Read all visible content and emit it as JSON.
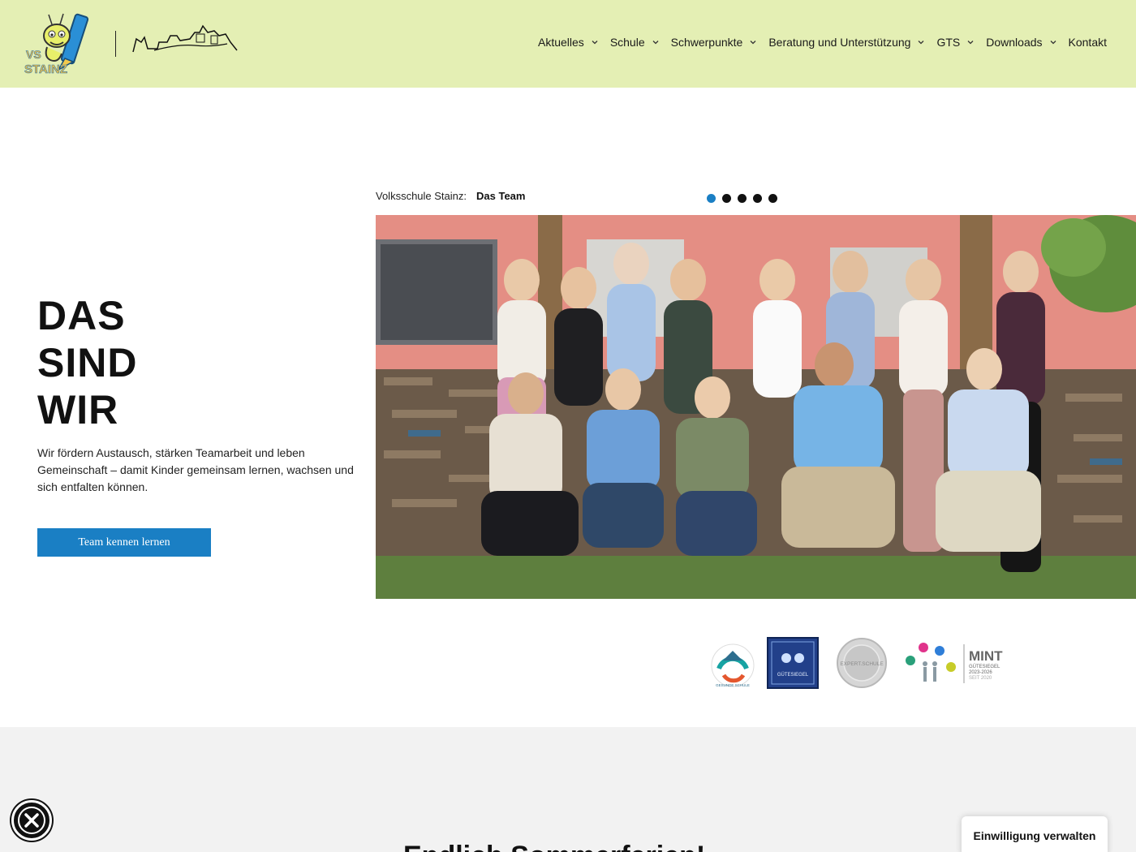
{
  "header": {
    "logo_text": "VS STAINZ",
    "nav": [
      {
        "label": "Aktuelles",
        "has_dropdown": true
      },
      {
        "label": "Schule",
        "has_dropdown": true
      },
      {
        "label": "Schwerpunkte",
        "has_dropdown": true
      },
      {
        "label": "Beratung und Unterstützung",
        "has_dropdown": true
      },
      {
        "label": "GTS",
        "has_dropdown": true
      },
      {
        "label": "Downloads",
        "has_dropdown": true
      },
      {
        "label": "Kontakt",
        "has_dropdown": false
      }
    ]
  },
  "hero": {
    "title_line1": "DAS",
    "title_line2": "SIND",
    "title_line3": "WIR",
    "text": "Wir fördern Austausch, stärken Teamarbeit und leben Gemeinschaft – damit Kinder gemeinsam lernen, wachsen und sich entfalten können.",
    "cta_label": "Team kennen lernen"
  },
  "slider": {
    "caption_prefix": "Volksschule Stainz:",
    "caption_title": "Das Team",
    "dot_count": 5,
    "active_dot": 0
  },
  "seals": {
    "ogb_text": "GESUNDE SCHULE",
    "schulsport_text": "GÜTESIEGEL",
    "expert_text": "EXPERT.SCHULE",
    "mint_title": "MINT",
    "mint_sub1": "GÜTESIEGEL",
    "mint_sub2": "2023-2026",
    "mint_sub3": "SEIT 2020"
  },
  "lower": {
    "title": "Endlich Sommerferien!"
  },
  "consent": {
    "label": "Einwilligung verwalten"
  },
  "colors": {
    "header_bg": "#e4efb4",
    "accent": "#1a7fc4",
    "lower_bg": "#f2f2f2"
  },
  "icons": {
    "dropdown": "chevron-down-icon",
    "accessibility": "accessibility-icon"
  }
}
